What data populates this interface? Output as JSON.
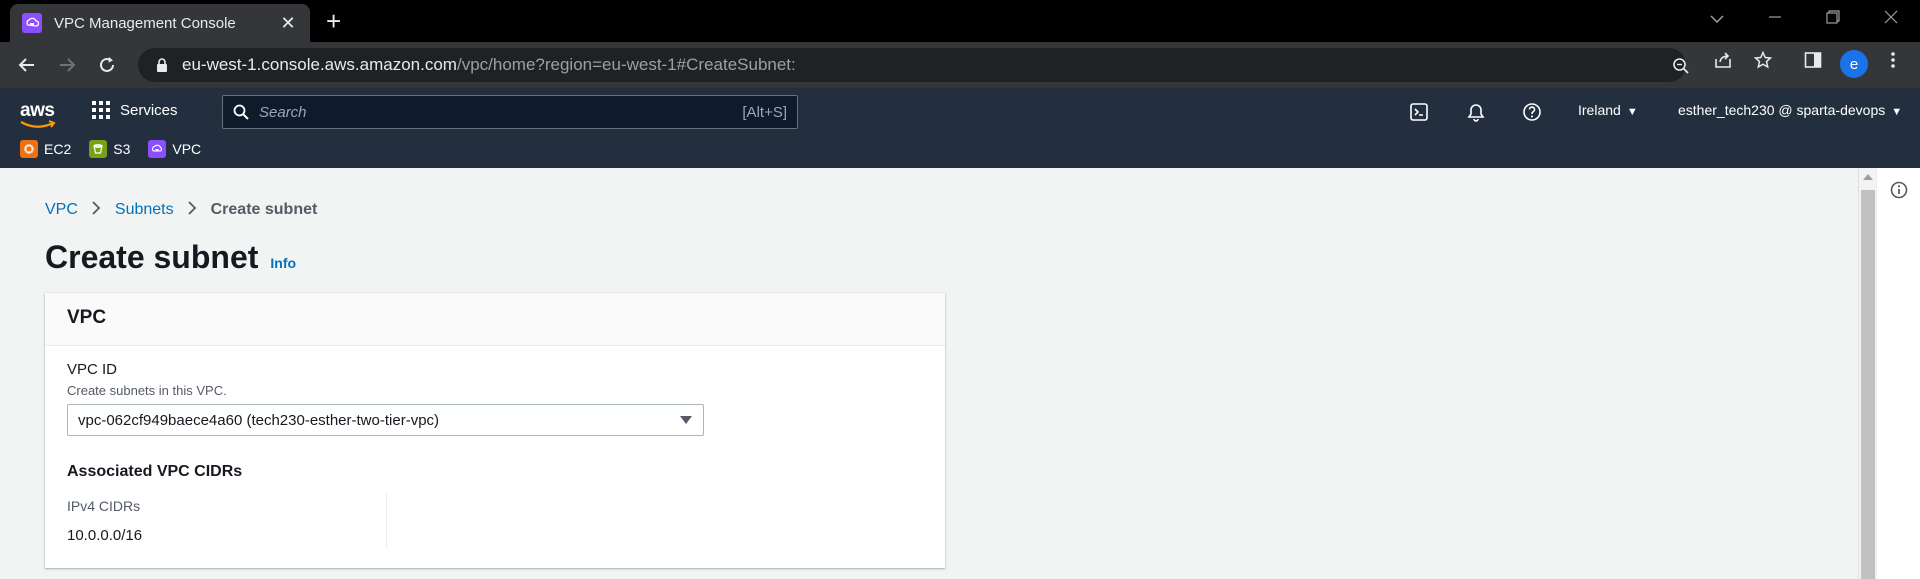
{
  "browser": {
    "tab_title": "VPC Management Console",
    "url_host": "eu-west-1.console.aws.amazon.com",
    "url_path": "/vpc/home?region=eu-west-1#CreateSubnet:",
    "profile_initial": "e"
  },
  "aws_nav": {
    "services_label": "Services",
    "search_placeholder": "Search",
    "search_shortcut": "[Alt+S]",
    "region": "Ireland",
    "account": "esther_tech230 @ sparta-devops",
    "favorites": [
      {
        "label": "EC2",
        "color": "#ec7211"
      },
      {
        "label": "S3",
        "color": "#7aa116"
      },
      {
        "label": "VPC",
        "color": "#8c4fff"
      }
    ]
  },
  "breadcrumb": {
    "items": [
      "VPC",
      "Subnets"
    ],
    "current": "Create subnet"
  },
  "page": {
    "title": "Create subnet",
    "info_label": "Info"
  },
  "vpc_panel": {
    "header": "VPC",
    "vpc_id_label": "VPC ID",
    "vpc_id_description": "Create subnets in this VPC.",
    "vpc_id_value": "vpc-062cf949baece4a60 (tech230-esther-two-tier-vpc)",
    "associated_title": "Associated VPC CIDRs",
    "ipv4_label": "IPv4 CIDRs",
    "ipv4_value": "10.0.0.0/16"
  },
  "colors": {
    "aws_nav_bg": "#232f3e",
    "link": "#0073bb",
    "vpc_purple": "#8c4fff"
  }
}
